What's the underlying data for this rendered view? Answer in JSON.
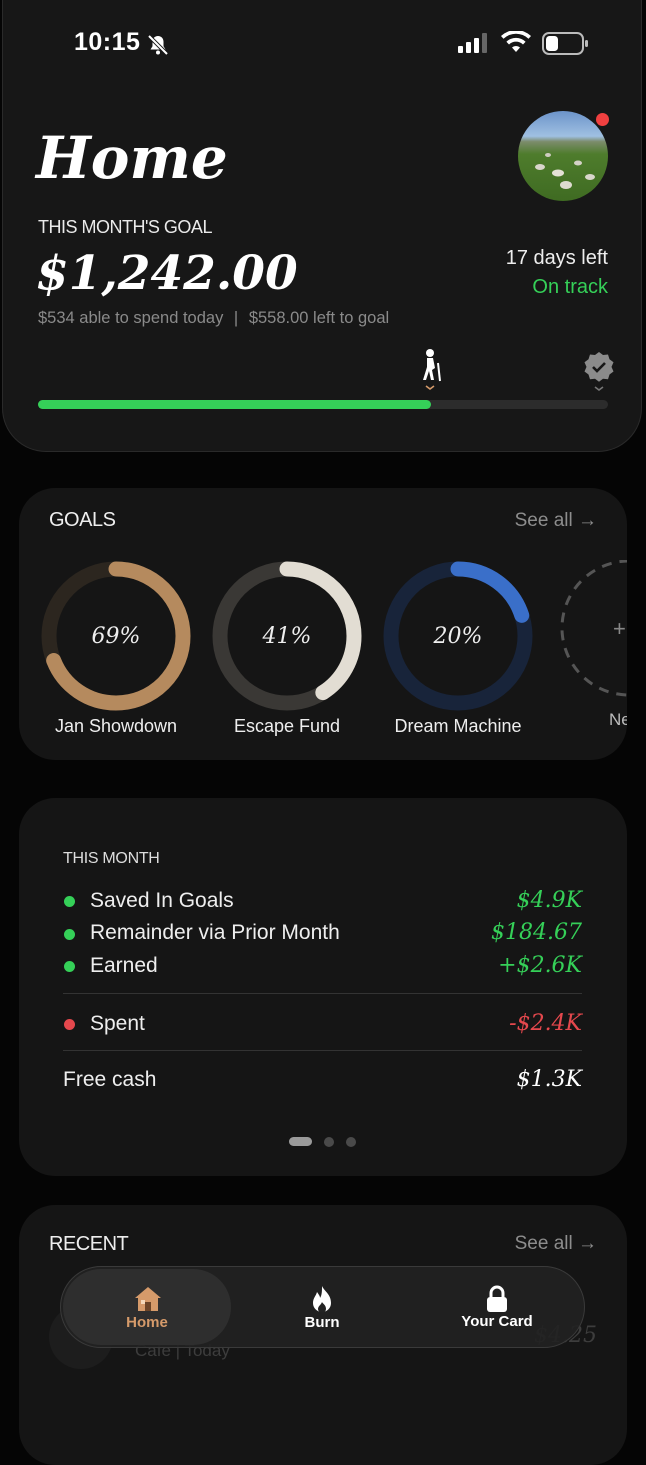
{
  "status": {
    "time": "10:15"
  },
  "header": {
    "title": "Home",
    "goal_label": "THIS MONTH'S GOAL",
    "goal_amount": "$1,242.00",
    "spend_today": "$534 able to spend today",
    "separator": "|",
    "left_to_goal": "$558.00 left to goal",
    "days_left": "17 days left",
    "status": "On track",
    "progress": 0.69
  },
  "goals": {
    "title": "GOALS",
    "see_all": "See all →",
    "items": [
      {
        "name": "Jan Showdown",
        "pct_label": "69%",
        "pct": 0.69,
        "color": "#b58a5e",
        "track": "#2c261f"
      },
      {
        "name": "Escape Fund",
        "pct_label": "41%",
        "pct": 0.41,
        "color": "#e2ddd3",
        "track": "#3a3835"
      },
      {
        "name": "Dream Machine",
        "pct_label": "20%",
        "pct": 0.2,
        "color": "#3a6fc9",
        "track": "#18243a"
      }
    ],
    "partial_label": "Ne",
    "partial_symbol": "+"
  },
  "month": {
    "title": "THIS MONTH",
    "rows": [
      {
        "label": "Saved In Goals",
        "value": "$4.9K"
      },
      {
        "label": "Remainder via Prior Month",
        "value": "$184.67"
      },
      {
        "label": "Earned",
        "value": "+$2.6K"
      }
    ],
    "spent_label": "Spent",
    "spent_value": "-$2.4K",
    "free_label": "Free cash",
    "free_value": "$1.3K"
  },
  "recent": {
    "title": "RECENT",
    "see_all": "See all →",
    "item_sub": "Cafe | Today",
    "item_amount": "$4.25"
  },
  "tabbar": {
    "home": "Home",
    "burn": "Burn",
    "card": "Your Card"
  },
  "colors": {
    "positive": "#35d058",
    "negative": "#e5484d",
    "accent_home": "#d59a6a"
  }
}
